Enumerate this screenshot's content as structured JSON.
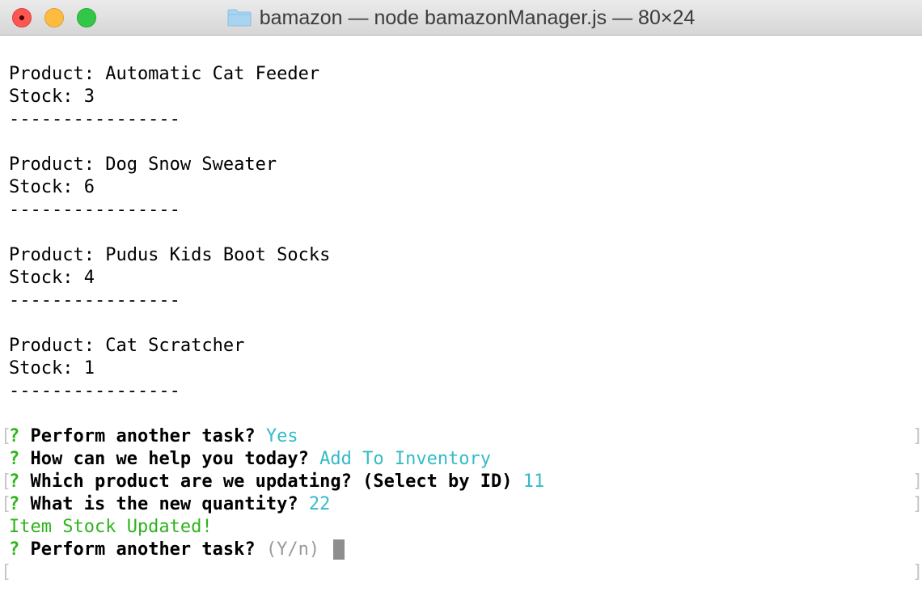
{
  "window": {
    "title": "bamazon — node bamazonManager.js — 80×24",
    "folder_icon": "folder-icon",
    "colors": {
      "close": "#fc5753",
      "minimize": "#fdbc40",
      "zoom": "#33c748"
    }
  },
  "terminal": {
    "products": [
      {
        "product_label": "Product: Automatic Cat Feeder",
        "stock_label": "Stock: 3",
        "separator": "----------------"
      },
      {
        "product_label": "Product: Dog Snow Sweater",
        "stock_label": "Stock: 6",
        "separator": "----------------"
      },
      {
        "product_label": "Product: Pudus Kids Boot Socks",
        "stock_label": "Stock: 4",
        "separator": "----------------"
      },
      {
        "product_label": "Product: Cat Scratcher",
        "stock_label": "Stock: 1",
        "separator": "----------------"
      }
    ],
    "prompts": [
      {
        "mark": "?",
        "question": "Perform another task?",
        "answer": "Yes"
      },
      {
        "mark": "?",
        "question": "How can we help you today?",
        "answer": "Add To Inventory"
      },
      {
        "mark": "?",
        "question": "Which product are we updating? (Select by ID)",
        "answer": "11"
      },
      {
        "mark": "?",
        "question": "What is the new quantity?",
        "answer": "22"
      }
    ],
    "success_message": "Item Stock Updated!",
    "current_prompt": {
      "mark": "?",
      "question": "Perform another task?",
      "hint": "(Y/n)"
    },
    "bracket_left": "[",
    "bracket_right": "]",
    "colors": {
      "prompt_mark": "#2fb41d",
      "answer": "#34bbc8",
      "hint": "#9a9a9a",
      "success": "#2fb41d"
    }
  }
}
